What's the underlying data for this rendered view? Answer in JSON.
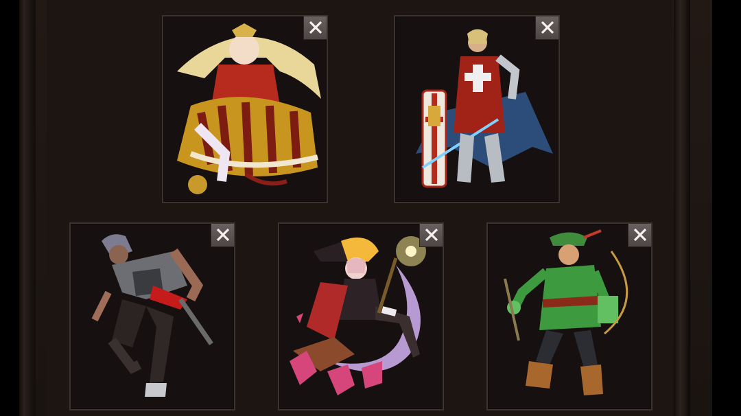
{
  "screen": {
    "title": "",
    "slot_count": 5
  },
  "slots": [
    {
      "character": "princess-mage",
      "close_icon": "close-icon"
    },
    {
      "character": "templar-knight",
      "close_icon": "close-icon"
    },
    {
      "character": "chainsaw-fighter",
      "close_icon": "close-icon"
    },
    {
      "character": "witch-on-crescent-moon",
      "close_icon": "close-icon"
    },
    {
      "character": "green-archer",
      "close_icon": "close-icon"
    }
  ],
  "colors": {
    "background": "#000000",
    "panel": "#1c1511",
    "slot_border": "#3b332e",
    "close_button": "#5c5553"
  }
}
